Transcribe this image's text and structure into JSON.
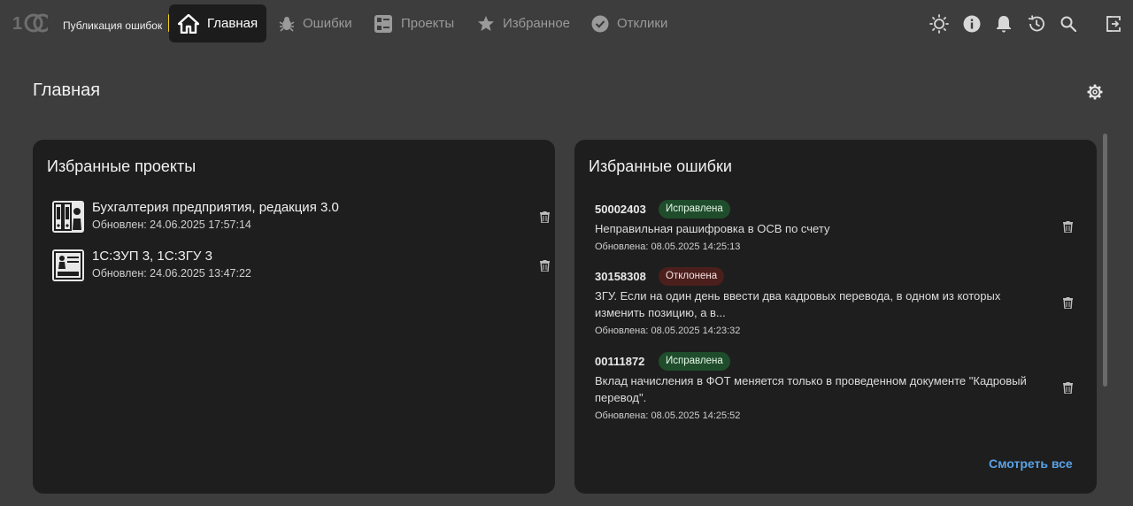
{
  "app": {
    "logo_text": "1С",
    "title": "Публикация ошибок"
  },
  "nav": {
    "items": [
      {
        "label": "Главная",
        "icon": "home-icon",
        "active": true
      },
      {
        "label": "Ошибки",
        "icon": "bug-icon",
        "active": false
      },
      {
        "label": "Проекты",
        "icon": "projects-icon",
        "active": false
      },
      {
        "label": "Избранное",
        "icon": "star-icon",
        "active": false
      },
      {
        "label": "Отклики",
        "icon": "check-circle-icon",
        "active": false
      }
    ]
  },
  "toolbar_icons": [
    "theme-sun-icon",
    "info-icon",
    "bell-icon",
    "history-icon",
    "search-icon",
    "logout-icon"
  ],
  "page": {
    "title": "Главная"
  },
  "favorite_projects": {
    "title": "Избранные проекты",
    "items": [
      {
        "name": "Бухгалтерия предприятия, редакция 3.0",
        "updated": "Обновлен: 24.06.2025 17:57:14"
      },
      {
        "name": "1С:ЗУП 3, 1С:ЗГУ 3",
        "updated": "Обновлен: 24.06.2025 13:47:22"
      }
    ]
  },
  "favorite_errors": {
    "title": "Избранные ошибки",
    "items": [
      {
        "id": "50002403",
        "status": "Исправлена",
        "status_type": "ok",
        "lines": [
          "Неправильная рашифровка в ОСВ по счету"
        ],
        "updated": "Обновлена: 08.05.2025 14:25:13"
      },
      {
        "id": "30158308",
        "status": "Отклонена",
        "status_type": "rejected",
        "lines": [
          "ЗГУ. Если на один день ввести два кадровых перевода, в одном из которых",
          "изменить позицию, а в..."
        ],
        "updated": "Обновлена: 08.05.2025 14:23:32"
      },
      {
        "id": "00111872",
        "status": "Исправлена",
        "status_type": "ok",
        "lines": [
          "Вклад начисления в ФОТ меняется только в проведенном документе \"Кадровый",
          "перевод\"."
        ],
        "updated": "Обновлена: 08.05.2025 14:25:52"
      }
    ],
    "see_all": "Смотреть все"
  },
  "colors": {
    "background": "#3d3d3d",
    "card": "#1e1e1e",
    "accent": "#f5d020",
    "link": "#5aa2e6",
    "badge_ok": "#1f4d2b",
    "badge_rejected": "#4a1f1c"
  }
}
